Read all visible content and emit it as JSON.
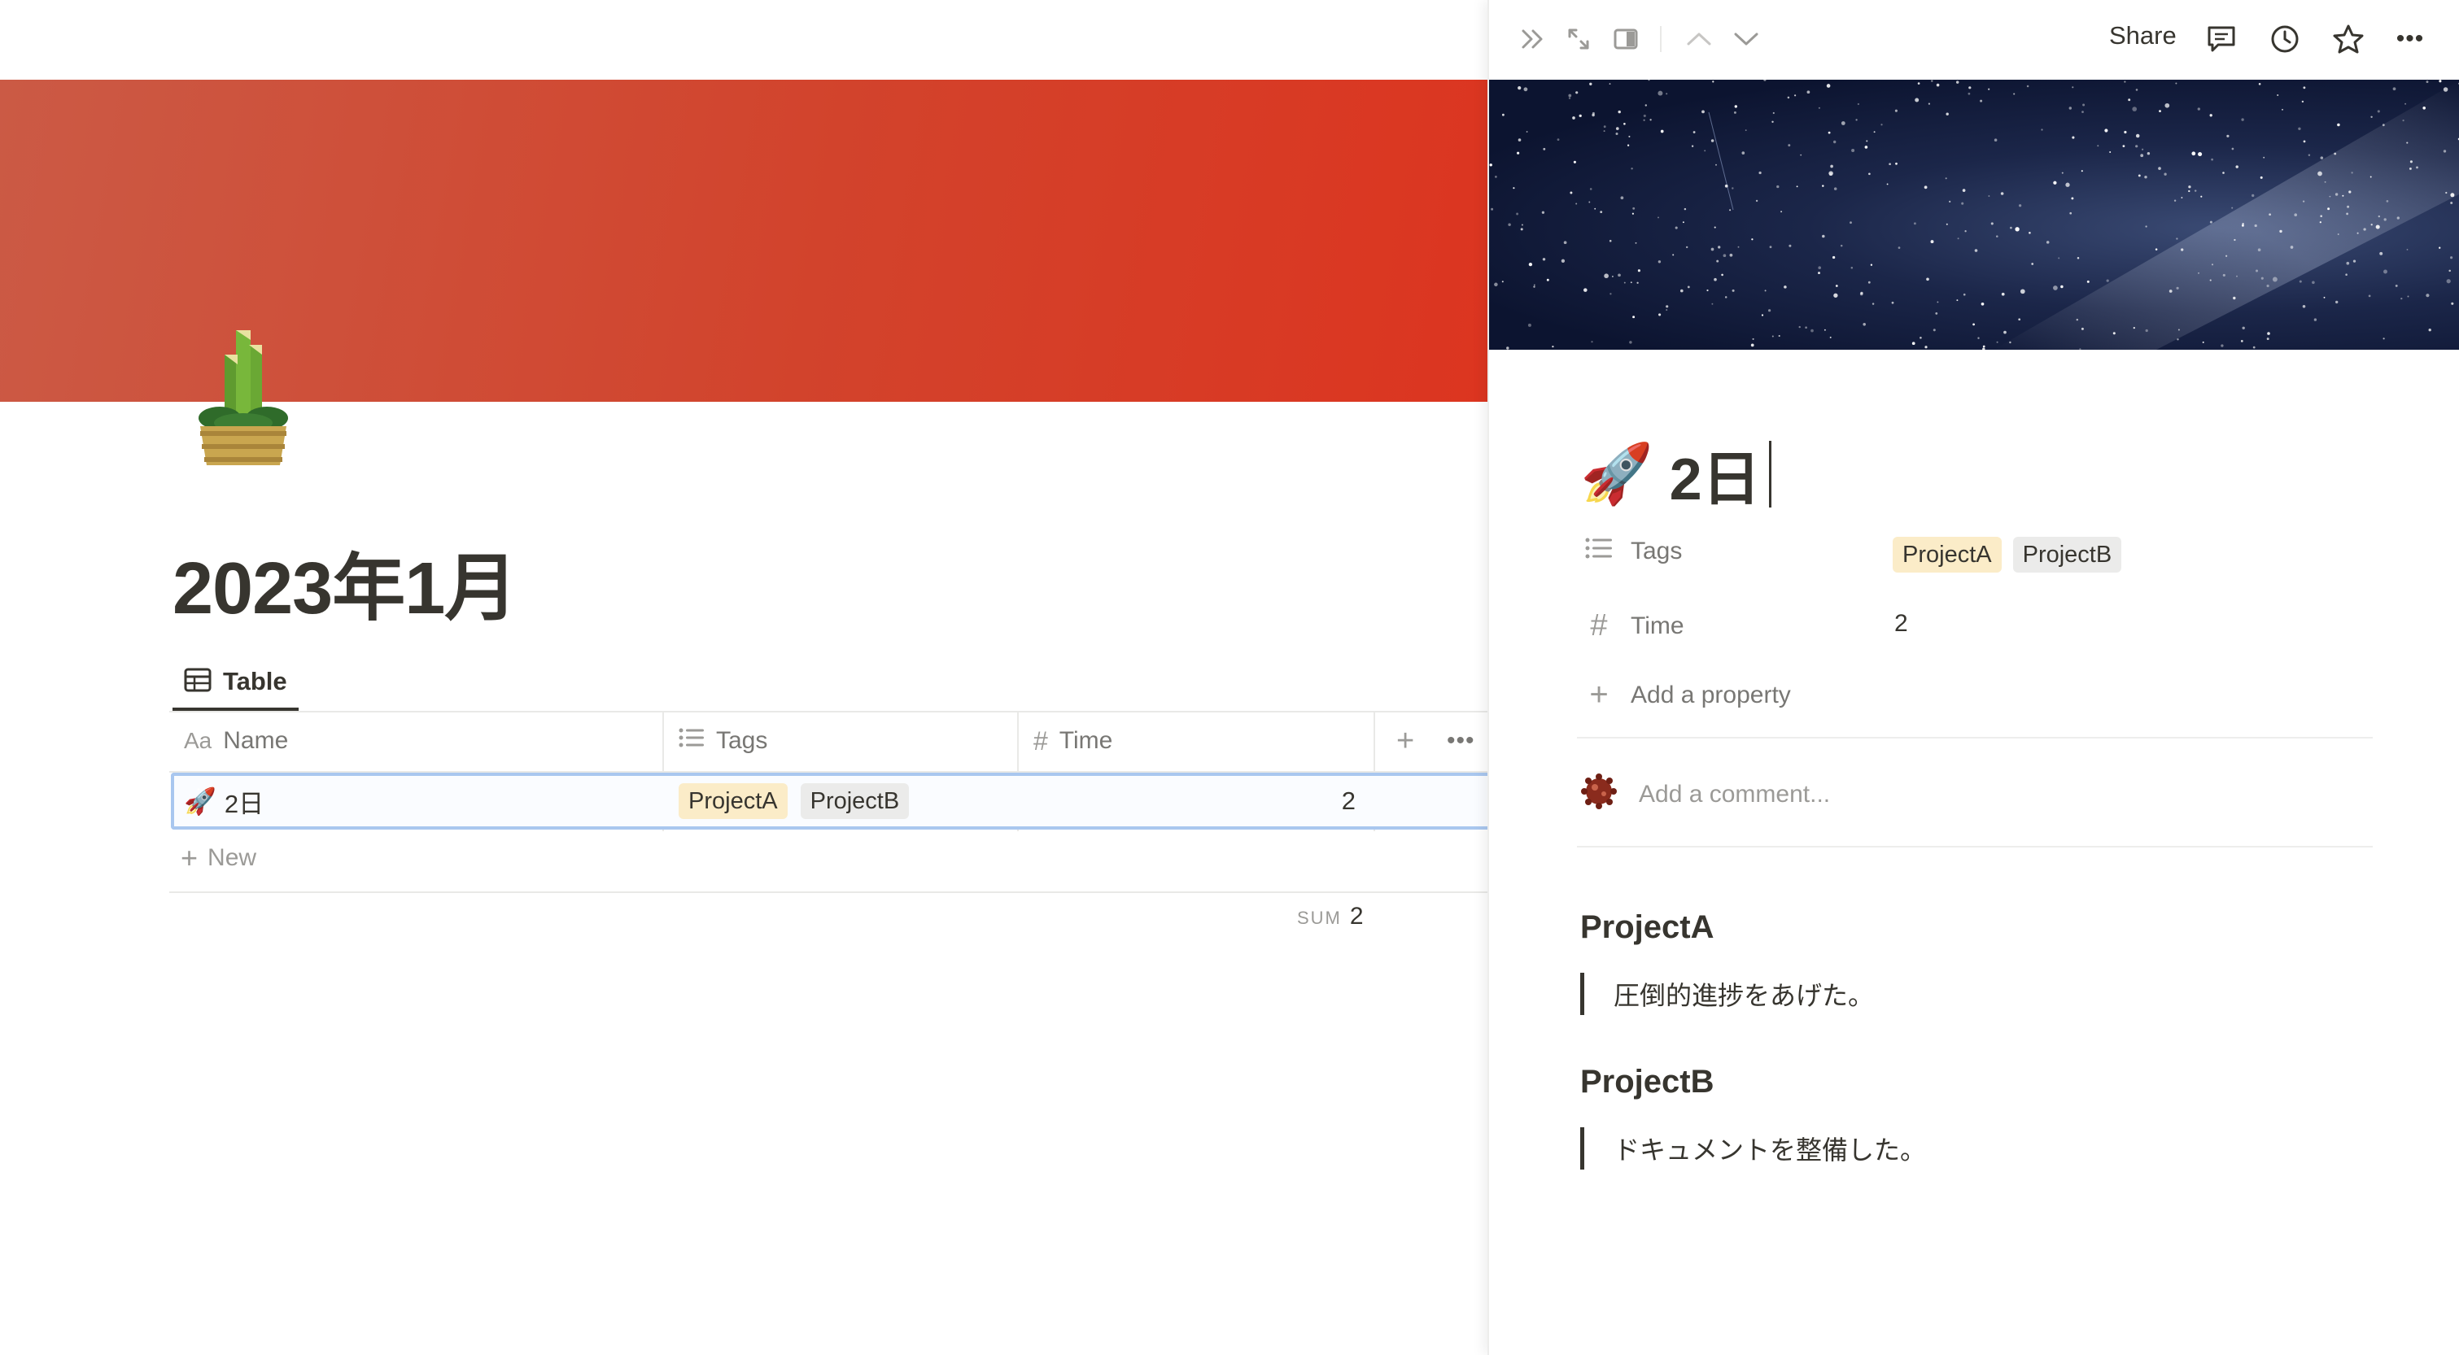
{
  "page": {
    "title": "2023年1月",
    "icon": "kadomatsu-icon",
    "cover_color": "#d2432c"
  },
  "view": {
    "tab_label": "Table"
  },
  "table": {
    "columns": [
      {
        "icon": "Aa",
        "label": "Name"
      },
      {
        "icon": "list-icon",
        "label": "Tags"
      },
      {
        "icon": "#",
        "label": "Time"
      }
    ],
    "rows": [
      {
        "icon": "🚀",
        "name": "2日",
        "tags": [
          "ProjectA",
          "ProjectB"
        ],
        "time": "2"
      }
    ],
    "new_label": "New",
    "sum_label": "SUM",
    "sum_value": "2"
  },
  "peek": {
    "share_label": "Share",
    "title_icon": "🚀",
    "title": "2日",
    "properties": [
      {
        "icon": "list-icon",
        "name": "Tags",
        "tags": [
          "ProjectA",
          "ProjectB"
        ]
      },
      {
        "icon": "#",
        "name": "Time",
        "value": "2"
      }
    ],
    "add_property_label": "Add a property",
    "comment_placeholder": "Add a comment...",
    "sections": [
      {
        "heading": "ProjectA",
        "quote": "圧倒的進捗をあげた。"
      },
      {
        "heading": "ProjectB",
        "quote": "ドキュメントを整備した。"
      }
    ],
    "tag_colors": {
      "ProjectA": "#fbecc8",
      "ProjectB": "#ebebea"
    }
  }
}
